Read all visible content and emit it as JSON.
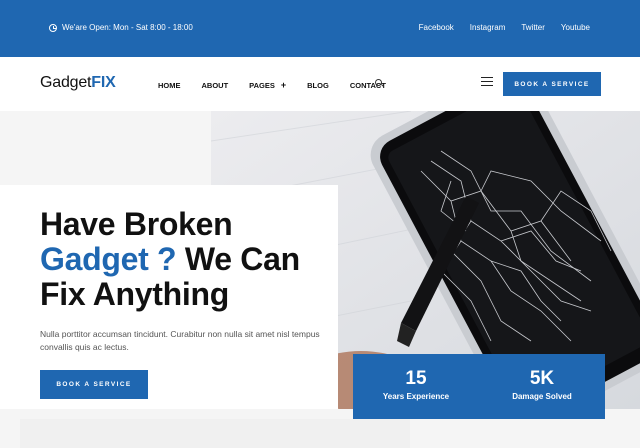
{
  "topbar": {
    "hours": "We'are Open: Mon - Sat 8:00 - 18:00",
    "social": [
      "Facebook",
      "Instagram",
      "Twitter",
      "Youtube"
    ]
  },
  "header": {
    "logo_main": "Gadget",
    "logo_accent": "FIX",
    "nav": [
      "HOME",
      "ABOUT",
      "PAGES",
      "BLOG",
      "CONTACT"
    ],
    "pages_plus": "+",
    "cta": "BOOK A SERVICE"
  },
  "hero": {
    "title_line1": "Have Broken",
    "title_blue": "Gadget ?",
    "title_rest": " We Can",
    "title_line3": "Fix Anything",
    "description": "Nulla porttitor accumsan tincidunt. Curabitur non nulla sit amet nisl tempus convallis quis ac lectus.",
    "button": "BOOK A SERVICE"
  },
  "stats": [
    {
      "number": "15",
      "label": "Years Experience"
    },
    {
      "number": "5K",
      "label": "Damage Solved"
    }
  ],
  "colors": {
    "brand": "#1f67b1",
    "dark": "#111111"
  }
}
